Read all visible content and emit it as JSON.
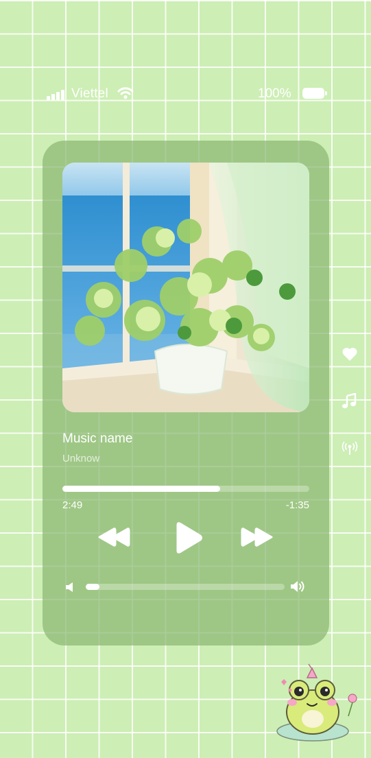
{
  "status_bar": {
    "carrier": "Viettel",
    "battery_percent": "100%",
    "signal_icon": "cellular-signal-icon",
    "wifi_icon": "wifi-icon",
    "battery_icon": "battery-full-icon"
  },
  "player": {
    "track_title": "Music name",
    "artist": "Unknow",
    "elapsed": "2:49",
    "remaining": "-1:35",
    "progress_fraction": 0.64,
    "volume_fraction": 0.07,
    "controls": [
      "rewind-icon",
      "play-icon",
      "fast-forward-icon"
    ],
    "volume_icons": [
      "volume-low-icon",
      "volume-high-icon"
    ]
  },
  "side_icons": [
    "heart-icon",
    "music-note-icon",
    "broadcast-icon"
  ],
  "sticker": "frog-sticker",
  "colors": {
    "background": "#cdeeb5",
    "grid_lines": "#ffffff",
    "card": "#8cb973",
    "accent": "#ffffff"
  }
}
